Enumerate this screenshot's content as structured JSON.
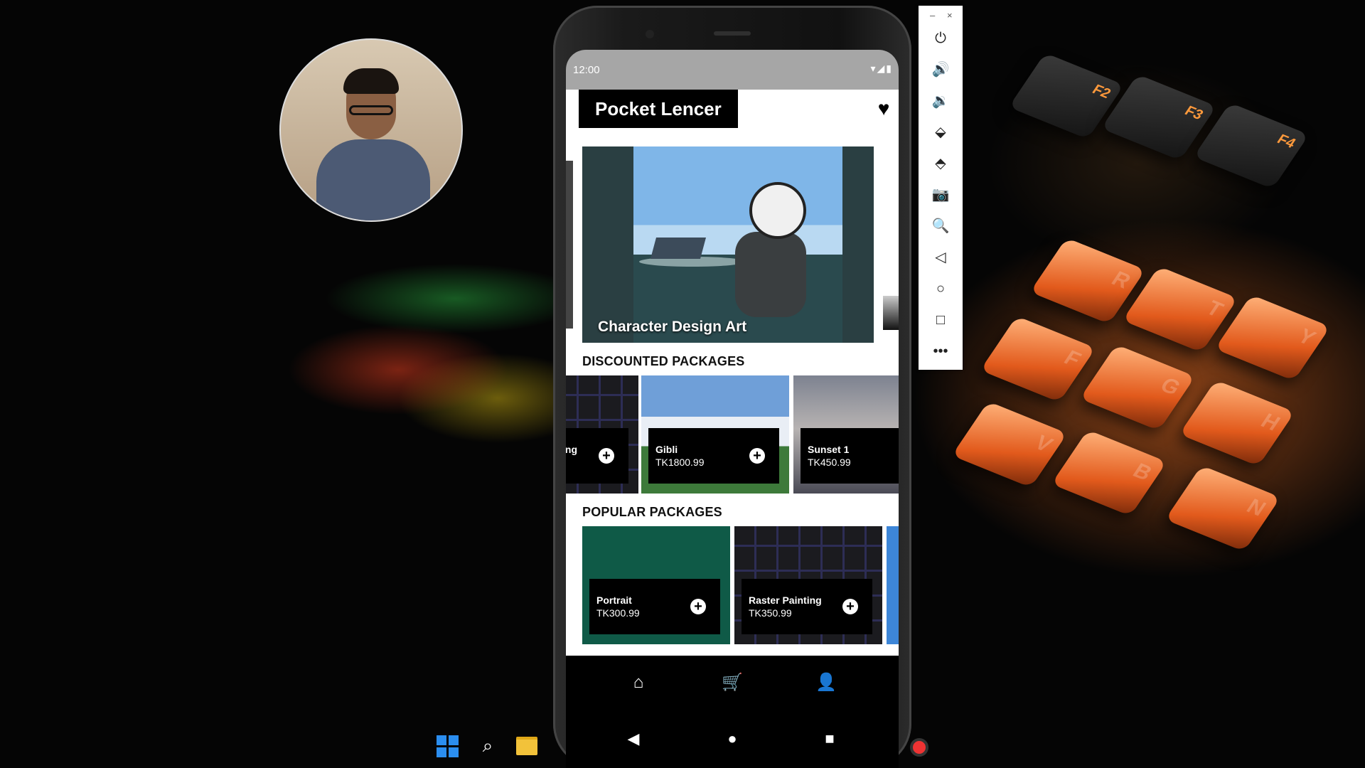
{
  "phone": {
    "status": {
      "time": "12:00",
      "icons": "▾◢▮"
    },
    "app": {
      "title": "Pocket Lencer",
      "favorites_icon": "heart-icon",
      "carousel": {
        "caption": "Character Design Art"
      },
      "discounted": {
        "title": "DISCOUNTED PACKAGES",
        "items": [
          {
            "name": "ting",
            "price": ""
          },
          {
            "name": "Gibli",
            "price": "TK1800.99"
          },
          {
            "name": "Sunset 1",
            "price": "TK450.99"
          }
        ]
      },
      "popular": {
        "title": "POPULAR PACKAGES",
        "items": [
          {
            "name": "Portrait",
            "price": "TK300.99"
          },
          {
            "name": "Raster Painting",
            "price": "TK350.99"
          }
        ]
      },
      "bottom_nav": {
        "items": [
          "home-icon",
          "cart-icon",
          "profile-icon"
        ]
      }
    },
    "system_nav": {
      "back": "◀",
      "home": "●",
      "recents": "■"
    }
  },
  "emulator_toolbar": {
    "window_controls": {
      "minimize": "–",
      "close": "×"
    },
    "tools": [
      "power-icon",
      "volume-up-icon",
      "volume-down-icon",
      "rotate-left-icon",
      "rotate-right-icon",
      "camera-icon",
      "zoom-icon",
      "back-icon",
      "home-icon",
      "overview-icon",
      "more-icon"
    ],
    "glyphs": [
      "⏻",
      "🔊",
      "🔉",
      "⬙",
      "⬘",
      "📷",
      "🔍",
      "◁",
      "○",
      "□",
      "•••"
    ]
  },
  "taskbar": {
    "icons": [
      "windows-start-icon",
      "search-icon",
      "file-explorer-icon"
    ]
  },
  "colors": {
    "accent": "#000000",
    "status_bar": "#a6a6a6",
    "background": "#050505"
  }
}
